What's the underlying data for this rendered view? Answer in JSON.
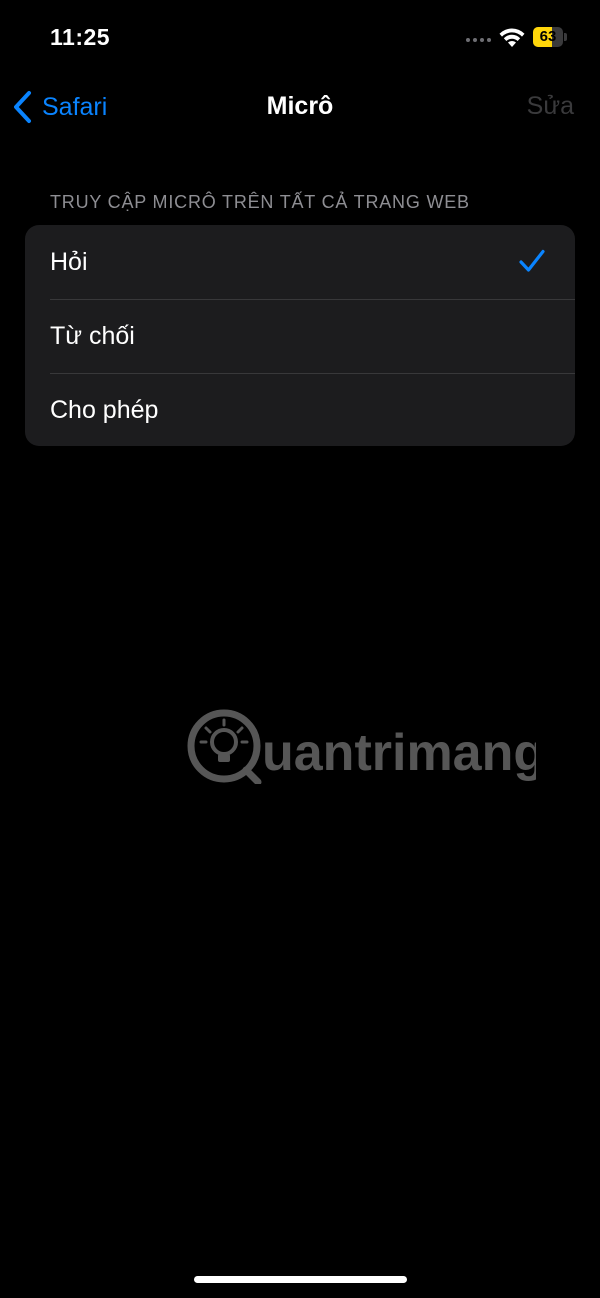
{
  "status_bar": {
    "time": "11:25",
    "battery_level": "63",
    "battery_fraction": 0.63
  },
  "nav": {
    "back_label": "Safari",
    "title": "Micrô",
    "edit_label": "Sửa"
  },
  "section": {
    "header": "TRUY CẬP MICRÔ TRÊN TẤT CẢ TRANG WEB",
    "options": [
      {
        "label": "Hỏi",
        "selected": true
      },
      {
        "label": "Từ chối",
        "selected": false
      },
      {
        "label": "Cho phép",
        "selected": false
      }
    ]
  },
  "watermark": {
    "text": "uantrimang"
  },
  "colors": {
    "accent": "#0a84ff",
    "battery": "#ffd60a",
    "background": "#000000",
    "group_background": "#1c1c1e",
    "secondary_text": "#8e8e93"
  },
  "icons": {
    "back": "chevron-left-icon",
    "check": "checkmark-icon",
    "wifi": "wifi-icon",
    "battery": "battery-icon",
    "watermark": "lightbulb-icon"
  }
}
